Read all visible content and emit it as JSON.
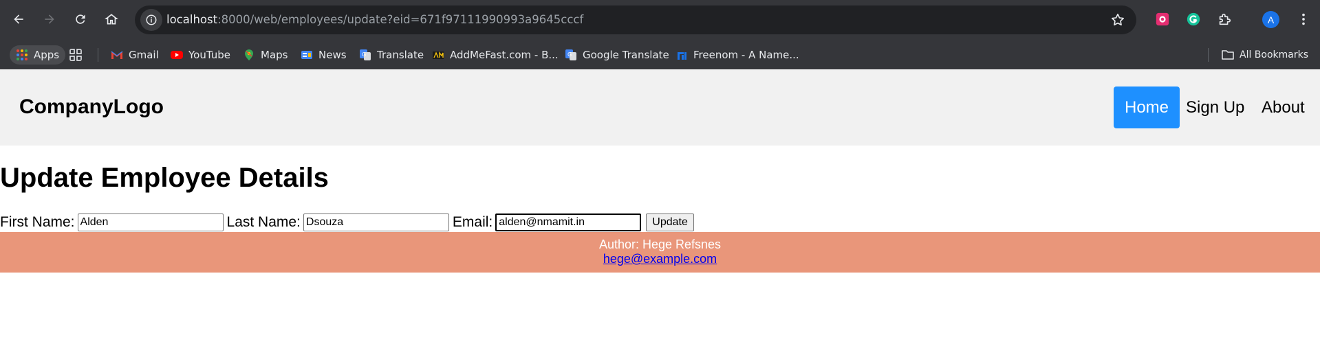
{
  "browser": {
    "url_host": "localhost",
    "url_path": ":8000/web/employees/update?eid=671f97111990993a9645cccf",
    "avatar_letter": "A",
    "bookmarks": [
      {
        "label": "Apps",
        "icon": "apps-grid-icon"
      },
      {
        "label": "Gmail",
        "icon": "gmail-icon",
        "color": "#ea4335"
      },
      {
        "label": "YouTube",
        "icon": "youtube-icon",
        "color": "#ff0000"
      },
      {
        "label": "Maps",
        "icon": "maps-pin-icon",
        "color": "#34a853"
      },
      {
        "label": "News",
        "icon": "google-news-icon",
        "color": "#4285f4"
      },
      {
        "label": "Translate",
        "icon": "google-translate-icon",
        "color": "#4285f4"
      },
      {
        "label": "AddMeFast.com - B...",
        "icon": "addmefast-icon",
        "color": "#222222"
      },
      {
        "label": "Google Translate",
        "icon": "google-translate-icon",
        "color": "#4285f4"
      },
      {
        "label": "Freenom - A Name...",
        "icon": "freenom-icon",
        "color": "#1a73e8"
      }
    ],
    "all_bookmarks_label": "All Bookmarks"
  },
  "header": {
    "logo": "CompanyLogo",
    "nav": [
      {
        "label": "Home",
        "active": true
      },
      {
        "label": "Sign Up",
        "active": false
      },
      {
        "label": "About",
        "active": false
      }
    ],
    "active_color": "#1e90ff"
  },
  "main": {
    "title": "Update Employee Details",
    "form": {
      "first_name_label": "First Name:",
      "first_name_value": "Alden",
      "last_name_label": "Last Name:",
      "last_name_value": "Dsouza",
      "email_label": "Email:",
      "email_value": "alden@nmamit.in",
      "submit_label": "Update"
    }
  },
  "footer": {
    "author": "Author: Hege Refsnes",
    "email": "hege@example.com",
    "background": "#e9967a"
  }
}
